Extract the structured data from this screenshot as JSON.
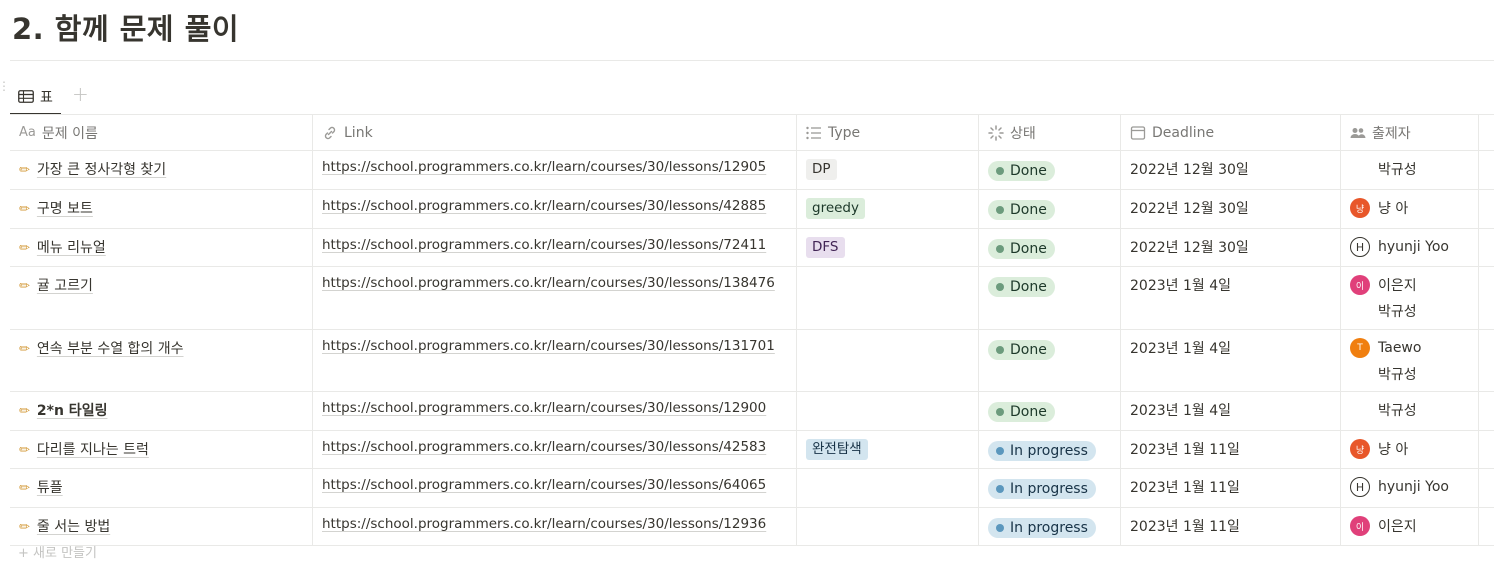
{
  "page": {
    "title": "2. 함께 문제 풀이"
  },
  "view": {
    "tab_label": "표",
    "add_symbol": "+"
  },
  "columns": {
    "name": "문제 이름",
    "name_icon": "Aa",
    "link": "Link",
    "type": "Type",
    "status": "상태",
    "deadline": "Deadline",
    "author": "출제자"
  },
  "colors": {
    "done_bg": "#dbeddb",
    "inprogress_bg": "#d3e5ef",
    "tag_dp": "#efefed",
    "tag_greedy": "#dbeddb",
    "tag_dfs": "#e8deee",
    "tag_full": "#d3e5ef"
  },
  "rows": [
    {
      "name": "가장 큰 정사각형 찾기",
      "link": "https://school.programmers.co.kr/learn/courses/30/lessons/12905",
      "type": "DP",
      "status": "Done",
      "deadline": "2022년 12월 30일",
      "authors": [
        {
          "name": "박규성",
          "avatar": ""
        }
      ]
    },
    {
      "name": "구명 보트",
      "link": "https://school.programmers.co.kr/learn/courses/30/lessons/42885",
      "type": "greedy",
      "status": "Done",
      "deadline": "2022년 12월 30일",
      "authors": [
        {
          "name": "냥 아",
          "avatar": "냥"
        }
      ]
    },
    {
      "name": "메뉴 리뉴얼",
      "link": "https://school.programmers.co.kr/learn/courses/30/lessons/72411",
      "type": "DFS",
      "status": "Done",
      "deadline": "2022년 12월 30일",
      "authors": [
        {
          "name": "hyunji Yoo",
          "avatar": "H"
        }
      ]
    },
    {
      "name": "귤 고르기",
      "link": "https://school.programmers.co.kr/learn/courses/30/lessons/138476",
      "type": "",
      "status": "Done",
      "deadline": "2023년 1월 4일",
      "authors": [
        {
          "name": "이은지",
          "avatar": "이"
        },
        {
          "name": "박규성",
          "avatar": ""
        }
      ]
    },
    {
      "name": "연속 부분 수열 합의 개수",
      "link": "https://school.programmers.co.kr/learn/courses/30/lessons/131701",
      "type": "",
      "status": "Done",
      "deadline": "2023년 1월 4일",
      "authors": [
        {
          "name": "Taewo",
          "avatar": "T"
        },
        {
          "name": "박규성",
          "avatar": ""
        }
      ]
    },
    {
      "name": "2*n 타일링",
      "link": "https://school.programmers.co.kr/learn/courses/30/lessons/12900",
      "type": "",
      "status": "Done",
      "deadline": "2023년 1월 4일",
      "authors": [
        {
          "name": "박규성",
          "avatar": ""
        }
      ]
    },
    {
      "name": "다리를 지나는 트럭",
      "link": "https://school.programmers.co.kr/learn/courses/30/lessons/42583",
      "type": "완전탐색",
      "status": "In progress",
      "deadline": "2023년 1월 11일",
      "authors": [
        {
          "name": "냥 아",
          "avatar": "냥"
        }
      ]
    },
    {
      "name": "튜플",
      "link": "https://school.programmers.co.kr/learn/courses/30/lessons/64065",
      "type": "",
      "status": "In progress",
      "deadline": "2023년 1월 11일",
      "authors": [
        {
          "name": "hyunji Yoo",
          "avatar": "H"
        }
      ]
    },
    {
      "name": "줄 서는 방법",
      "link": "https://school.programmers.co.kr/learn/courses/30/lessons/12936",
      "type": "",
      "status": "In progress",
      "deadline": "2023년 1월 11일",
      "authors": [
        {
          "name": "이은지",
          "avatar": "이"
        }
      ]
    }
  ],
  "footer": {
    "new_label": "+ 새로 만들기"
  }
}
